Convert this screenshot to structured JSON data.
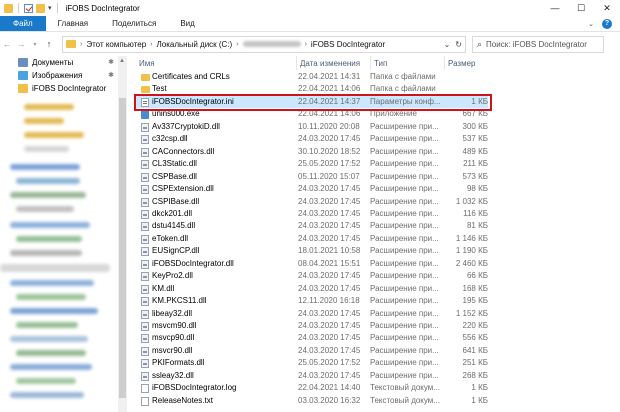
{
  "window": {
    "title": "iFOBS DocIntegrator",
    "controls": {
      "minimize": "—",
      "maximize": "☐",
      "close": "✕"
    }
  },
  "ribbon": {
    "tabs": [
      {
        "label": "Файл",
        "active": true
      },
      {
        "label": "Главная"
      },
      {
        "label": "Поделиться"
      },
      {
        "label": "Вид"
      }
    ],
    "help": "?"
  },
  "address": {
    "crumbs": [
      "Этот компьютер",
      "Локальный диск (C:)",
      "iFOBS DocIntegrator"
    ],
    "search_placeholder": "Поиск: iFOBS DocIntegrator"
  },
  "sidebar": {
    "pinned": [
      {
        "label": "Документы",
        "icon": "documents-icon"
      },
      {
        "label": "Изображения",
        "icon": "pictures-icon"
      },
      {
        "label": "iFOBS DocIntegrator",
        "icon": "folder-icon"
      }
    ]
  },
  "columns": {
    "name": "Имя",
    "date": "Дата изменения",
    "type": "Тип",
    "size": "Размер"
  },
  "files": [
    {
      "name": "Certificates and CRLs",
      "date": "22.04.2021 14:31",
      "type": "Папка с файлами",
      "size": "",
      "icon": "folder"
    },
    {
      "name": "Test",
      "date": "22.04.2021 14:06",
      "type": "Папка с файлами",
      "size": "",
      "icon": "folder"
    },
    {
      "name": "iFOBSDocIntegrator.ini",
      "date": "22.04.2021 14:37",
      "type": "Параметры конф...",
      "size": "1 КБ",
      "icon": "ini",
      "selected": true
    },
    {
      "name": "unins000.exe",
      "date": "22.04.2021 14:06",
      "type": "Приложение",
      "size": "667 КБ",
      "icon": "exe"
    },
    {
      "name": "Av337CryptokiD.dll",
      "date": "10.11.2020 20:08",
      "type": "Расширение при...",
      "size": "300 КБ",
      "icon": "dll"
    },
    {
      "name": "c32csp.dll",
      "date": "24.03.2020 17:45",
      "type": "Расширение при...",
      "size": "537 КБ",
      "icon": "dll"
    },
    {
      "name": "CAConnectors.dll",
      "date": "30.10.2020 18:52",
      "type": "Расширение при...",
      "size": "489 КБ",
      "icon": "dll"
    },
    {
      "name": "CL3Static.dll",
      "date": "25.05.2020 17:52",
      "type": "Расширение при...",
      "size": "211 КБ",
      "icon": "dll"
    },
    {
      "name": "CSPBase.dll",
      "date": "05.11.2020 15:07",
      "type": "Расширение при...",
      "size": "573 КБ",
      "icon": "dll"
    },
    {
      "name": "CSPExtension.dll",
      "date": "24.03.2020 17:45",
      "type": "Расширение при...",
      "size": "98 КБ",
      "icon": "dll"
    },
    {
      "name": "CSPIBase.dll",
      "date": "24.03.2020 17:45",
      "type": "Расширение при...",
      "size": "1 032 КБ",
      "icon": "dll"
    },
    {
      "name": "dkck201.dll",
      "date": "24.03.2020 17:45",
      "type": "Расширение при...",
      "size": "116 КБ",
      "icon": "dll"
    },
    {
      "name": "dstu4145.dll",
      "date": "24.03.2020 17:45",
      "type": "Расширение при...",
      "size": "81 КБ",
      "icon": "dll"
    },
    {
      "name": "eToken.dll",
      "date": "24.03.2020 17:45",
      "type": "Расширение при...",
      "size": "1 146 КБ",
      "icon": "dll"
    },
    {
      "name": "EUSignCP.dll",
      "date": "18.01.2021 10:58",
      "type": "Расширение при...",
      "size": "1 190 КБ",
      "icon": "dll"
    },
    {
      "name": "iFOBSDocIntegrator.dll",
      "date": "08.04.2021 15:51",
      "type": "Расширение при...",
      "size": "2 460 КБ",
      "icon": "dll"
    },
    {
      "name": "KeyPro2.dll",
      "date": "24.03.2020 17:45",
      "type": "Расширение при...",
      "size": "66 КБ",
      "icon": "dll"
    },
    {
      "name": "KM.dll",
      "date": "24.03.2020 17:45",
      "type": "Расширение при...",
      "size": "168 КБ",
      "icon": "dll"
    },
    {
      "name": "KM.PKCS11.dll",
      "date": "12.11.2020 16:18",
      "type": "Расширение при...",
      "size": "195 КБ",
      "icon": "dll"
    },
    {
      "name": "libeay32.dll",
      "date": "24.03.2020 17:45",
      "type": "Расширение при...",
      "size": "1 152 КБ",
      "icon": "dll"
    },
    {
      "name": "msvcm90.dll",
      "date": "24.03.2020 17:45",
      "type": "Расширение при...",
      "size": "220 КБ",
      "icon": "dll"
    },
    {
      "name": "msvcp90.dll",
      "date": "24.03.2020 17:45",
      "type": "Расширение при...",
      "size": "556 КБ",
      "icon": "dll"
    },
    {
      "name": "msvcr90.dll",
      "date": "24.03.2020 17:45",
      "type": "Расширение при...",
      "size": "641 КБ",
      "icon": "dll"
    },
    {
      "name": "PKIFormats.dll",
      "date": "25.05.2020 17:52",
      "type": "Расширение при...",
      "size": "251 КБ",
      "icon": "dll"
    },
    {
      "name": "ssleay32.dll",
      "date": "24.03.2020 17:45",
      "type": "Расширение при...",
      "size": "268 КБ",
      "icon": "dll"
    },
    {
      "name": "iFOBSDocIntegrator.log",
      "date": "22.04.2021 14:40",
      "type": "Текстовый докум...",
      "size": "1 КБ",
      "icon": "file"
    },
    {
      "name": "ReleaseNotes.txt",
      "date": "03.03.2020 16:32",
      "type": "Текстовый докум...",
      "size": "1 КБ",
      "icon": "file"
    }
  ]
}
